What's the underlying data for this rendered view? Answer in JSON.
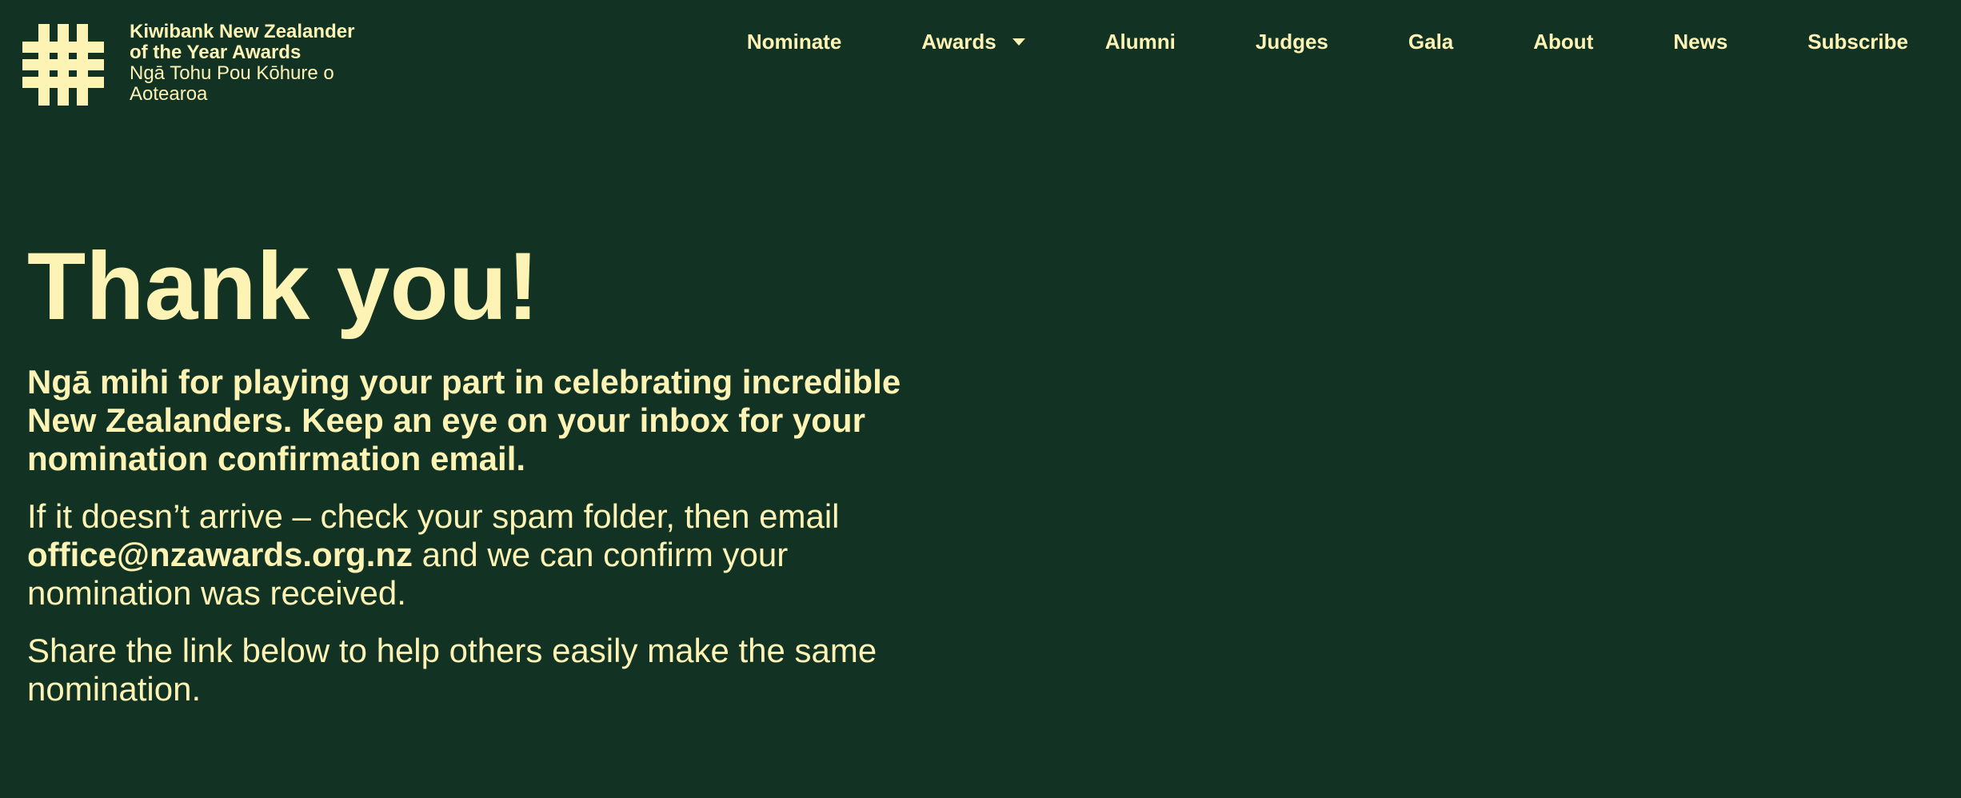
{
  "colors": {
    "background": "#123324",
    "text": "#FCF3B5"
  },
  "logo": {
    "icon": "hash-icon",
    "name": "Kiwibank New Zealander of the Year Awards",
    "maori_name": "Ngā Tohu Pou Kōhure o Aotearoa"
  },
  "nav": {
    "items": [
      {
        "label": "Nominate"
      },
      {
        "label": "Awards",
        "icon": "chevron-down-icon"
      },
      {
        "label": "Alumni"
      },
      {
        "label": "Judges"
      },
      {
        "label": "Gala"
      },
      {
        "label": "About"
      },
      {
        "label": "News"
      },
      {
        "label": "Subscribe"
      }
    ]
  },
  "main": {
    "heading": "Thank you!",
    "lead": "Ngā mihi for playing your part in celebrating incredible New Zealanders. Keep an eye on your inbox for your nomination confirmation email.",
    "spam_note_before": "If it doesn’t arrive – check your spam folder, then email ",
    "email": "office@nzawards.org.nz",
    "spam_note_after": " and we can confirm your nomination was received.",
    "share_text": "Share the link below to help others easily make the same nomination."
  }
}
